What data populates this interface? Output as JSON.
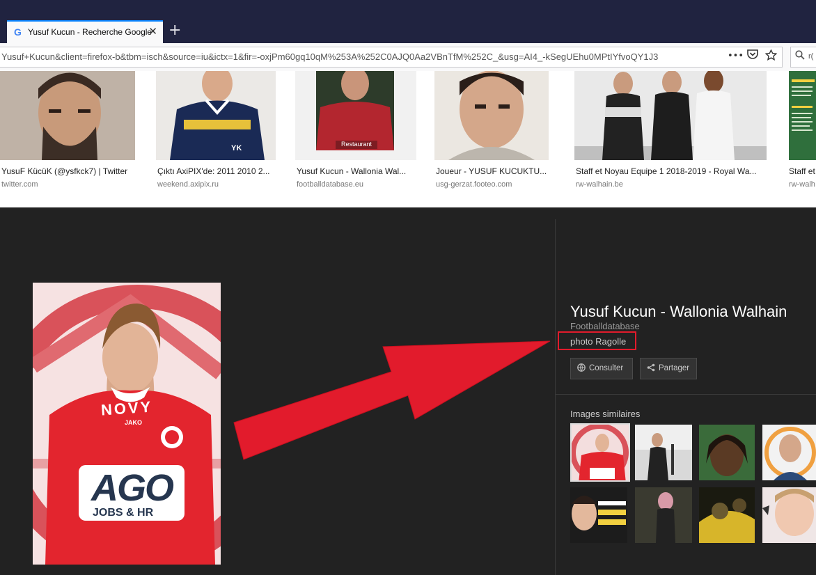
{
  "tab": {
    "title": "Yusuf Kucun - Recherche Google",
    "logo": "G",
    "close": "✕"
  },
  "browser": {
    "new_tab": "+",
    "url": "Yusuf+Kucun&client=firefox-b&tbm=isch&source=iu&ictx=1&fir=-oxjPm60gq10qM%253A%252C0AJQ0Aa2VBnTfM%252C_&usg=AI4_-kSegUEhu0MPtIYfvoQY1J3",
    "page_actions": "•••",
    "search_partial": "r("
  },
  "results": [
    {
      "caption": "YusuF KücüK (@ysfkck7) | Twitter",
      "domain": "twitter.com"
    },
    {
      "caption": "Çıktı AxiPIX'de: 2011 2010 2...",
      "domain": "weekend.axipix.ru"
    },
    {
      "caption": "Yusuf Kucun - Wallonia Wal...",
      "domain": "footballdatabase.eu"
    },
    {
      "caption": "Joueur - YUSUF KUCUKTU...",
      "domain": "usg-gerzat.footeo.com"
    },
    {
      "caption": "Staff et Noyau Equipe 1 2018-2019 - Royal Wa...",
      "domain": "rw-walhain.be"
    },
    {
      "caption": "Staff et",
      "domain": "rw-walh"
    }
  ],
  "thumb_text": {
    "jersey_initials": "YK",
    "sponsor_2": "Restaurant"
  },
  "detail": {
    "title": "Yusuf Kucun - Wallonia Walhain",
    "source": "Footballdatabase",
    "credit": "photo Ragolle",
    "visit_label": "Consulter",
    "share_label": "Partager",
    "similar_label": "Images similaires"
  },
  "main_image": {
    "sponsor": "AGO",
    "sponsor_sub": "JOBS & HR",
    "brand": "JAKO",
    "jersey_text": "NOVY"
  },
  "annotation": {
    "color": "#e21b2c"
  },
  "colors": {
    "titlebar": "#202340",
    "panel": "#222222",
    "accent": "#0a84ff"
  },
  "icons": [
    "google-g-icon",
    "close-icon",
    "plus-icon",
    "more-icon",
    "pocket-icon",
    "star-icon",
    "search-icon",
    "globe-icon",
    "share-icon"
  ]
}
